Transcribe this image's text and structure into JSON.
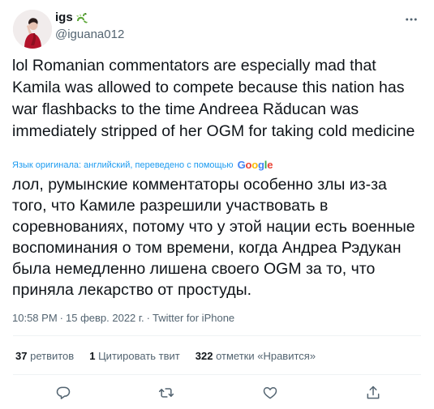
{
  "user": {
    "display_name": "igs",
    "handle": "@iguana012"
  },
  "tweet": {
    "text": "lol Romanian commentators are especially mad that Kamila was allowed to compete because this nation has war flashbacks to the time Andreea Răducan was immediately stripped of her OGM for taking cold medicine",
    "translation_note": "Язык оригинала: английский, переведено с помощью",
    "translation_provider": "Google",
    "translated_text": "лол, румынские комментаторы особенно злы из-за того, что Камиле разрешили участвовать в соревнованиях, потому что у этой нации есть военные воспоминания о том времени, когда Андреа Рэдукан была немедленно лишена своего OGM за то, что приняла лекарство от простуды."
  },
  "meta": {
    "time": "10:58 PM",
    "separator": "·",
    "date": "15 февр. 2022 г.",
    "source": "Twitter for iPhone"
  },
  "stats": {
    "retweets_count": "37",
    "retweets_label": "ретвитов",
    "quotes_count": "1",
    "quotes_label": "Цитировать твит",
    "likes_count": "322",
    "likes_label": "отметки «Нравится»"
  },
  "icons": {
    "more": "more-horizontal-icon",
    "reply": "reply-icon",
    "retweet": "retweet-icon",
    "like": "heart-icon",
    "share": "share-icon",
    "name_emoji": "dragon-emoji-icon"
  },
  "colors": {
    "text": "#0f1419",
    "secondary": "#536471",
    "link": "#1d9bf0",
    "divider": "#eff3f4"
  }
}
